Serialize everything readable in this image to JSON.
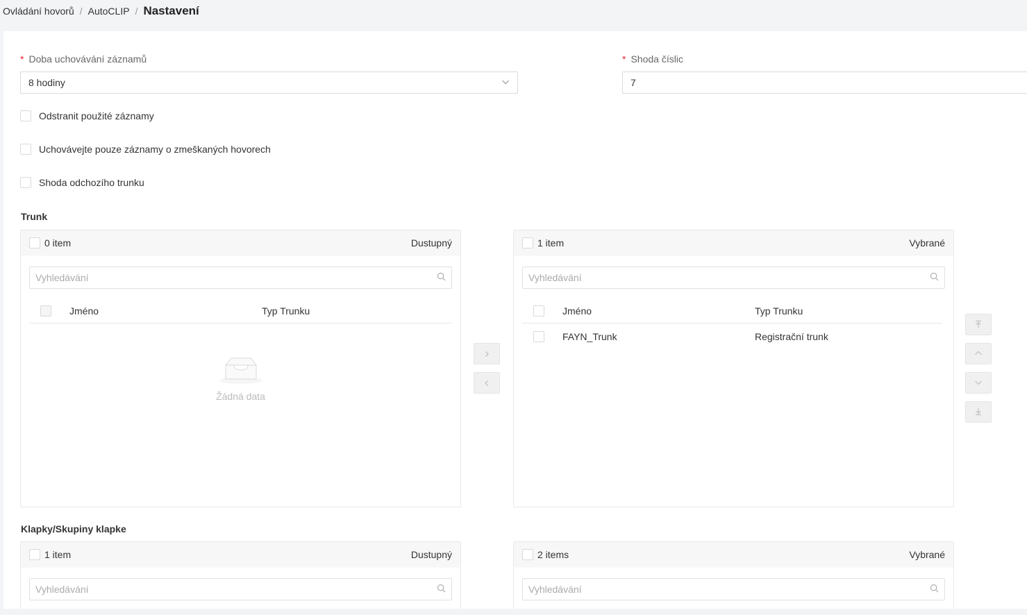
{
  "breadcrumb": {
    "item1": "Ovládání hovorů",
    "item2": "AutoCLIP",
    "current": "Nastavení",
    "separator": "/"
  },
  "form": {
    "retention": {
      "required_mark": "*",
      "label": "Doba uchovávání záznamů",
      "value": "8 hodiny"
    },
    "digit_match": {
      "required_mark": "*",
      "label": "Shoda číslic",
      "value": "7"
    },
    "checkboxes": [
      {
        "label": "Odstranit použité záznamy",
        "checked": false
      },
      {
        "label": "Uchovávejte pouze záznamy o zmeškaných hovorech",
        "checked": false
      },
      {
        "label": "Shoda odchozího trunku",
        "checked": false
      }
    ]
  },
  "trunk": {
    "title": "Trunk",
    "left": {
      "count": "0 item",
      "header": "Dustupný",
      "search_placeholder": "Vyhledávání",
      "col_name": "Jméno",
      "col_type": "Typ Trunku",
      "empty_text": "Žádná data"
    },
    "right": {
      "count": "1 item",
      "header": "Vybrané",
      "search_placeholder": "Vyhledávání",
      "col_name": "Jméno",
      "col_type": "Typ Trunku",
      "rows": [
        {
          "name": "FAYN_Trunk",
          "type": "Registrační trunk"
        }
      ]
    }
  },
  "extensions": {
    "title": "Klapky/Skupiny klapke",
    "left": {
      "count": "1 item",
      "header": "Dustupný",
      "search_placeholder": "Vyhledávání"
    },
    "right": {
      "count": "2 items",
      "header": "Vybrané",
      "search_placeholder": "Vyhledávání"
    }
  },
  "icons": {
    "transfer_right": "chevron-right-icon",
    "transfer_left": "chevron-left-icon",
    "move_top": "arrow-to-top-icon",
    "move_up": "chevron-up-icon",
    "move_down": "chevron-down-icon",
    "move_bottom": "arrow-to-bottom-icon"
  },
  "colors": {
    "required": "#f5222d",
    "border": "#d9d9d9",
    "panel_header": "#f7f7f7",
    "page_bg": "#f3f4f6"
  }
}
